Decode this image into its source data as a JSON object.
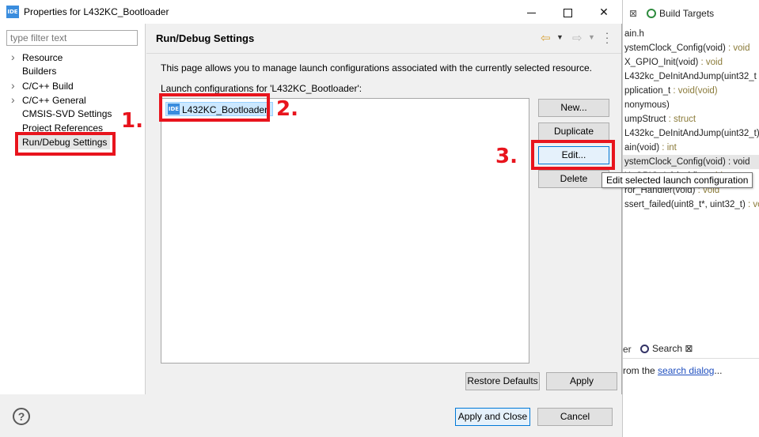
{
  "window": {
    "icon_label": "IDE",
    "title": "Properties for L432KC_Bootloader"
  },
  "filter": {
    "placeholder": "type filter text",
    "value": ""
  },
  "tree": {
    "items": [
      {
        "label": "Resource",
        "expandable": true
      },
      {
        "label": "Builders",
        "expandable": false
      },
      {
        "label": "C/C++ Build",
        "expandable": true
      },
      {
        "label": "C/C++ General",
        "expandable": true
      },
      {
        "label": "CMSIS-SVD Settings",
        "expandable": false
      },
      {
        "label": "Project References",
        "expandable": false
      },
      {
        "label": "Run/Debug Settings",
        "expandable": false,
        "selected": true
      }
    ]
  },
  "page": {
    "title": "Run/Debug Settings",
    "description": "This page allows you to manage launch configurations associated with the currently selected resource.",
    "list_label": "Launch configurations for 'L432KC_Bootloader':",
    "configurations": [
      {
        "icon_label": "IDE",
        "name": "L432KC_Bootloader"
      }
    ]
  },
  "buttons": {
    "new": "New...",
    "duplicate": "Duplicate",
    "edit": "Edit...",
    "delete": "Delete",
    "restore_defaults": "Restore Defaults",
    "apply": "Apply",
    "apply_and_close": "Apply and Close",
    "cancel": "Cancel"
  },
  "tooltip": "Edit selected launch configuration",
  "annotations": [
    "1.",
    "2.",
    "3."
  ],
  "colors": {
    "annotation": "#e8141d",
    "selection": "#cce8ff",
    "focus_border": "#0078d7"
  },
  "background_ide": {
    "tab_close": "⊠",
    "build_targets_tab": "Build Targets",
    "outline": [
      {
        "name": "ain.h",
        "sig": ""
      },
      {
        "name": "ystemClock_Config(void)",
        "sig": " : void"
      },
      {
        "name": "X_GPIO_Init(void)",
        "sig": " : void"
      },
      {
        "name": "L432kc_DeInitAndJump(uint32_t",
        "sig": ""
      },
      {
        "name": "pplication_t",
        "sig": " : void(void)"
      },
      {
        "name": "nonymous)",
        "sig": ""
      },
      {
        "name": "umpStruct",
        "sig": " : struct"
      },
      {
        "name": "L432kc_DeInitAndJump(uint32_t)",
        "sig": ""
      },
      {
        "name": "ain(void)",
        "sig": " : int"
      },
      {
        "name": "ystemClock_Config(void) : void",
        "sig": "",
        "selected": true
      },
      {
        "name": "X_GPIO_Init(void)",
        "sig": " : void"
      },
      {
        "name": "ror_Handler(void)",
        "sig": " : void"
      },
      {
        "name": "ssert_failed(uint8_t*, uint32_t)",
        "sig": " : vo"
      }
    ],
    "search_tab_partial": "er",
    "search_tab": "Search",
    "search_msg_prefix": "rom the ",
    "search_msg_link": "search dialog",
    "search_msg_suffix": "..."
  }
}
